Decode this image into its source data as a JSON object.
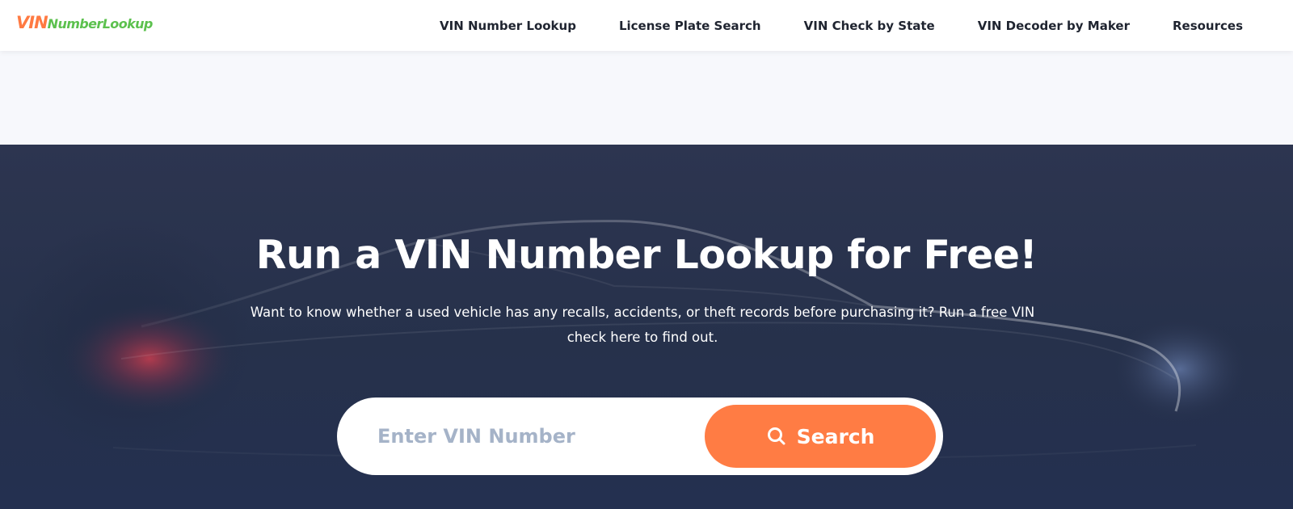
{
  "header": {
    "logo": {
      "vin": "VIN",
      "rest": "NumberLookup"
    },
    "nav": [
      {
        "label": "VIN Number Lookup"
      },
      {
        "label": "License Plate Search"
      },
      {
        "label": "VIN Check by State"
      },
      {
        "label": "VIN Decoder by Maker"
      },
      {
        "label": "Resources"
      }
    ]
  },
  "hero": {
    "title": "Run a VIN Number Lookup for Free!",
    "subtitle": "Want to know whether a used vehicle has any recalls, accidents, or theft records before purchasing it? Run a free VIN check here to find out.",
    "search": {
      "placeholder": "Enter VIN Number",
      "value": "",
      "button_label": "Search",
      "button_icon": "search-icon"
    }
  },
  "colors": {
    "accent": "#ff7c44",
    "brand_green": "#5cc14e",
    "hero_bg": "#26314b",
    "nav_text": "#1f2430",
    "placeholder": "#a5b3c8"
  }
}
